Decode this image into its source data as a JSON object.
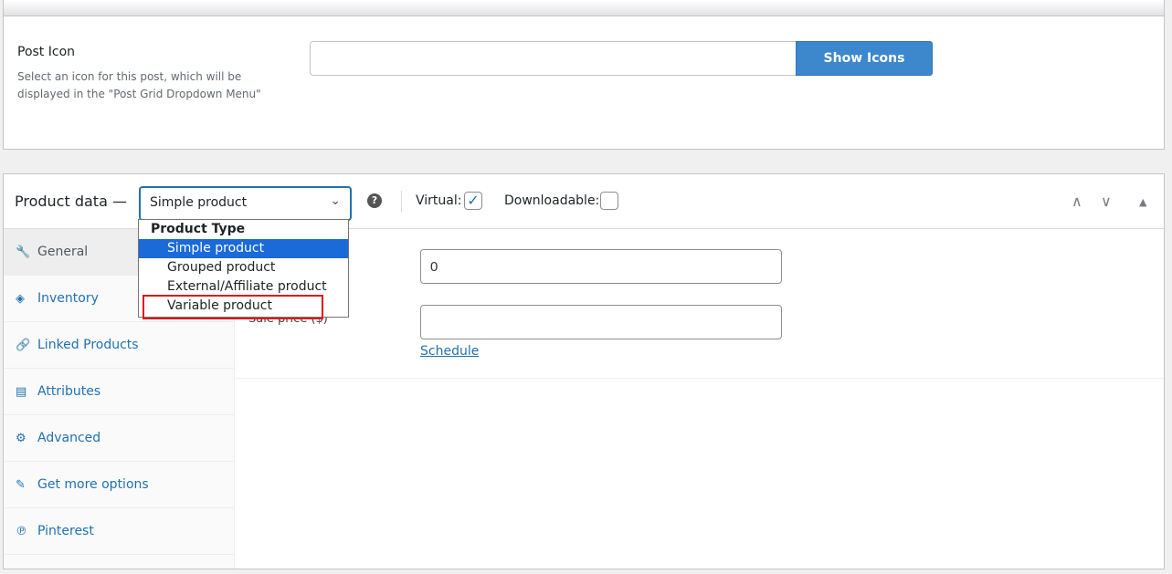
{
  "post_icon": {
    "title": "Post Icon",
    "description": "Select an icon for this post, which will be displayed in the \"Post Grid Dropdown Menu\"",
    "input_value": "",
    "button": "Show Icons"
  },
  "product_data": {
    "title": "Product data —",
    "type_select": {
      "value": "Simple product",
      "group_label": "Product Type",
      "options": [
        "Simple product",
        "Grouped product",
        "External/Affiliate product",
        "Variable product"
      ],
      "highlighted": "Simple product",
      "annotated": "Variable product"
    },
    "virtual_label": "Virtual:",
    "virtual_checked": true,
    "downloadable_label": "Downloadable:",
    "downloadable_checked": false,
    "tabs": [
      {
        "label": "General",
        "icon": "wrench-icon",
        "glyph": "🔧"
      },
      {
        "label": "Inventory",
        "icon": "tag-icon",
        "glyph": "◈"
      },
      {
        "label": "Linked Products",
        "icon": "link-icon",
        "glyph": "🔗"
      },
      {
        "label": "Attributes",
        "icon": "list-icon",
        "glyph": "▤"
      },
      {
        "label": "Advanced",
        "icon": "gear-icon",
        "glyph": "⚙"
      },
      {
        "label": "Get more options",
        "icon": "plugin-icon",
        "glyph": "✎"
      },
      {
        "label": "Pinterest",
        "icon": "pinterest-icon",
        "glyph": "℗"
      }
    ],
    "regular_price_value": "0",
    "sale_price_label": "Sale price ($)",
    "sale_price_value": "",
    "schedule_link": "Schedule"
  },
  "colors": {
    "accent": "#2271b1",
    "button": "#3d88cc",
    "highlight": "#1a6ad8",
    "annotation": "#e0161d"
  }
}
